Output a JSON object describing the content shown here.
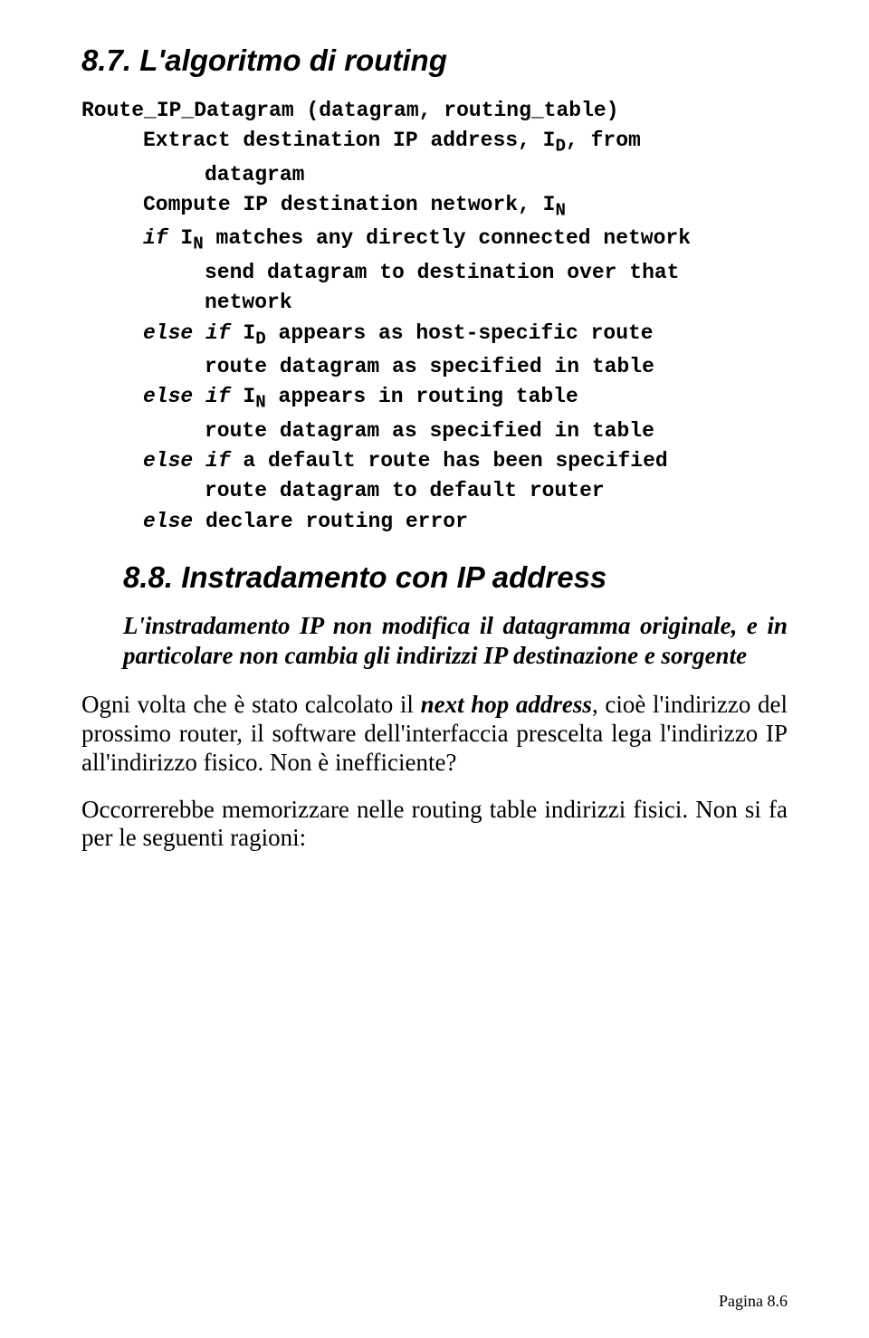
{
  "section1": {
    "heading": "8.7.  L'algoritmo di routing"
  },
  "code": {
    "l1": "Route_IP_Datagram (datagram, routing_table)",
    "l2a": "Extract destination IP address, I",
    "l2b": "D",
    "l2c": ", from",
    "l3": "datagram",
    "l4a": "Compute IP destination network, I",
    "l4b": "N",
    "l5a": "if",
    "l5b": " I",
    "l5c": "N",
    "l5d": " matches any directly connected network",
    "l6": "send datagram to destination over that",
    "l7": "network",
    "l8a": "else if",
    "l8b": " I",
    "l8c": "D",
    "l8d": " appears as host-specific route",
    "l9": "route datagram as specified in table",
    "l10a": "else if",
    "l10b": " I",
    "l10c": "N",
    "l10d": " appears in routing table",
    "l11": "route datagram as specified in table",
    "l12a": "else if",
    "l12b": " a default route has been specified",
    "l13": "route datagram to default router",
    "l14a": "else",
    "l14b": " declare routing error"
  },
  "section2": {
    "heading": "8.8. Instradamento con IP address",
    "emph": "L'instradamento IP non modifica il datagramma originale, e in particolare non cambia gli indirizzi IP destinazione e sorgente",
    "p1_a": "Ogni volta che è stato calcolato il ",
    "p1_nh": "next hop address",
    "p1_b": ", cioè l'indirizzo del prossimo router, il software dell'interfaccia prescelta lega l'indirizzo IP all'indirizzo fisico. Non è inefficiente?",
    "p2": "Occorrerebbe memorizzare nelle routing table indirizzi fisici. Non si fa per le seguenti ragioni:"
  },
  "footer": "Pagina 8.6"
}
